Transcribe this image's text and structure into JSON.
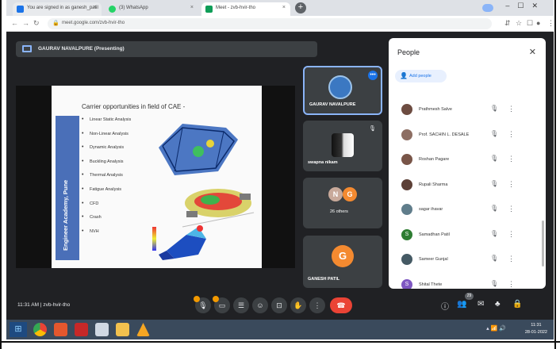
{
  "browser": {
    "tabs": [
      {
        "label": "You are signed in as ganesh_patil",
        "close": "×",
        "favicon_color": "#1a73e8"
      },
      {
        "label": "(3) WhatsApp",
        "close": "×",
        "favicon_color": "#25d366"
      },
      {
        "label": "Meet - zvb-hvir-tho",
        "close": "×",
        "favicon_color": "#0f9d58"
      }
    ],
    "new_tab": "+",
    "address": "meet.google.com/zvb-hvir-tho"
  },
  "meet": {
    "presenting_label": "GAURAV NAVALPURE (Presenting)",
    "slide": {
      "side_label": "Engineer Academy, Pune",
      "title": "Carrier opportunities in field of CAE -",
      "bullets": [
        "Linear Static Analysis",
        "Non-Linear Analysis",
        "Dynamic Analysis",
        "Buckling Analysis",
        "Thermal Analysis",
        "Fatigue Analysis",
        "CFD",
        "Crash",
        "NVH"
      ]
    },
    "tiles": [
      {
        "name": "GAURAV NAVALPURE"
      },
      {
        "name": "swapna nikam"
      },
      {
        "name": "26 others",
        "avatars": [
          "N",
          "G"
        ]
      },
      {
        "name": "GANESH PATIL",
        "avatar": "G"
      }
    ],
    "time": "11:31 AM",
    "separator": "|",
    "meeting_code": "zvb-hvir-tho",
    "participant_badge": "29"
  },
  "people": {
    "title": "People",
    "add_label": "Add people",
    "participants": [
      {
        "name": "Prathmesh Salve",
        "color": "#6d4c41"
      },
      {
        "name": "Prof. SACHIN L. DESALE",
        "color": "#8d6e63"
      },
      {
        "name": "Roshan Pagare",
        "color": "#795548"
      },
      {
        "name": "Rupali Sharma",
        "color": "#5d4037"
      },
      {
        "name": "sagar ihavar",
        "color": "#607d8b"
      },
      {
        "name": "Samadhan Patil",
        "color": "#2e7d32",
        "initial": "S"
      },
      {
        "name": "Sameer Gunjal",
        "color": "#455a64"
      },
      {
        "name": "Shital Thete",
        "color": "#7e57c2",
        "initial": "S"
      }
    ]
  },
  "taskbar": {
    "time": "11:31",
    "date": "28-01-2022"
  }
}
